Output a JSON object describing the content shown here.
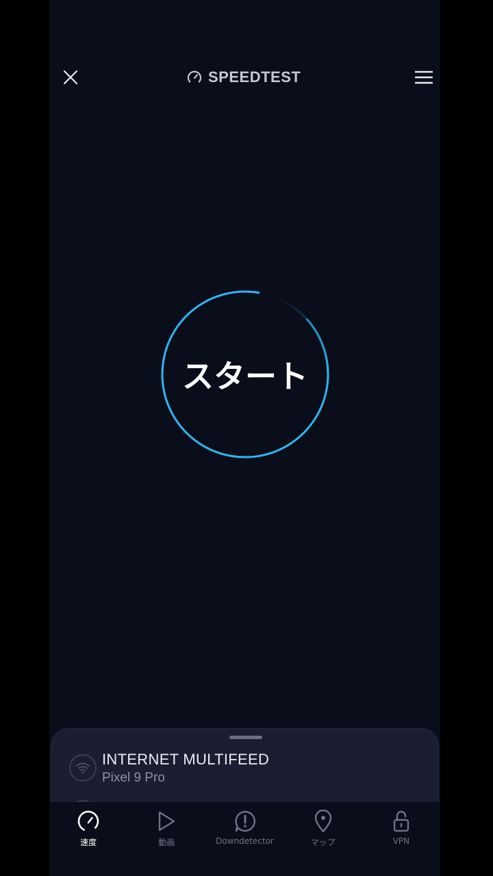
{
  "header": {
    "brand": "SPEEDTEST"
  },
  "start_button": {
    "label": "スタート"
  },
  "sheet": {
    "provider": "INTERNET MULTIFEED",
    "device": "Pixel 9 Pro"
  },
  "nav": {
    "items": [
      {
        "label": "速度",
        "icon": "speedometer-icon",
        "active": true
      },
      {
        "label": "動画",
        "icon": "play-icon",
        "active": false
      },
      {
        "label": "Downdetector",
        "icon": "alert-bubble-icon",
        "active": false
      },
      {
        "label": "マップ",
        "icon": "map-pin-icon",
        "active": false
      },
      {
        "label": "VPN",
        "icon": "unlock-icon",
        "active": false
      }
    ]
  },
  "colors": {
    "background": "#0a0d1a",
    "accent": "#2eb6f0",
    "sheet": "#1a1e30",
    "inactive": "#6f7385"
  }
}
